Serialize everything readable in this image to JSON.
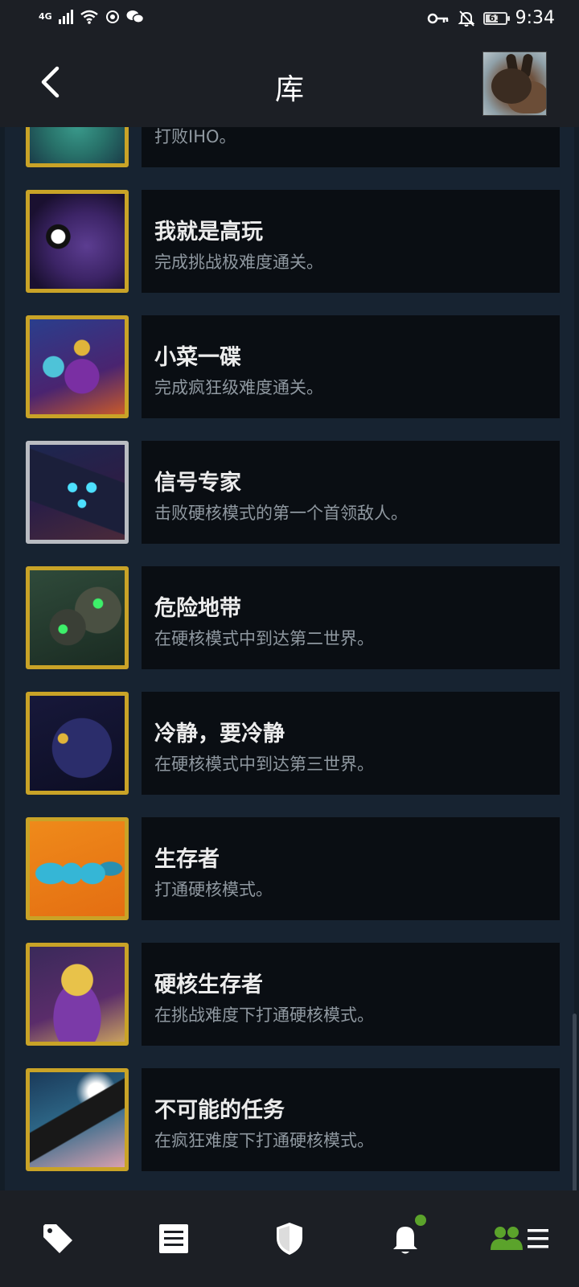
{
  "status_bar": {
    "network": "4G",
    "time": "9:34",
    "battery": "61",
    "battery_level": 0.61,
    "icons": [
      "signal-icon",
      "wifi-icon",
      "hotspot-icon",
      "wechat-icon",
      "key-icon",
      "mute-bell-icon",
      "battery-icon"
    ]
  },
  "header": {
    "title": "库",
    "back_icon": "chevron-left-icon",
    "avatar": "user-avatar-rabbit"
  },
  "achievements": [
    {
      "name": "",
      "desc": "打败IHO。",
      "icon": "green-monster-icon"
    },
    {
      "name": "我就是高玩",
      "desc": "完成挑战极难度通关。",
      "icon": "purple-beast-icon"
    },
    {
      "name": "小菜一碟",
      "desc": "完成疯狂级难度通关。",
      "icon": "heroes-group-icon"
    },
    {
      "name": "信号专家",
      "desc": "击败硬核模式的第一个首领敌人。",
      "icon": "robot-screen-icon"
    },
    {
      "name": "危险地带",
      "desc": "在硬核模式中到达第二世界。",
      "icon": "green-eyed-creatures-icon"
    },
    {
      "name": "冷静，要冷静",
      "desc": "在硬核模式中到达第三世界。",
      "icon": "dark-blob-icon"
    },
    {
      "name": "生存者",
      "desc": "打通硬核模式。",
      "icon": "blue-pins-icon"
    },
    {
      "name": "硬核生存者",
      "desc": "在挑战难度下打通硬核模式。",
      "icon": "golden-helmet-knight-icon"
    },
    {
      "name": "不可能的任务",
      "desc": "在疯狂难度下打通硬核模式。",
      "icon": "spaceship-icon"
    }
  ],
  "bottom_nav": [
    {
      "icon": "tag-icon",
      "label": ""
    },
    {
      "icon": "news-icon",
      "label": ""
    },
    {
      "icon": "shield-icon",
      "label": ""
    },
    {
      "icon": "notification-bell-icon",
      "label": "",
      "has_badge": true
    },
    {
      "icon": "friends-menu-icon",
      "label": "",
      "active": true
    }
  ],
  "colors": {
    "accent_green": "#5ba32b",
    "gold_border": "#c9a327",
    "card_bg": "#0a0e13",
    "list_bg": "#172331"
  }
}
